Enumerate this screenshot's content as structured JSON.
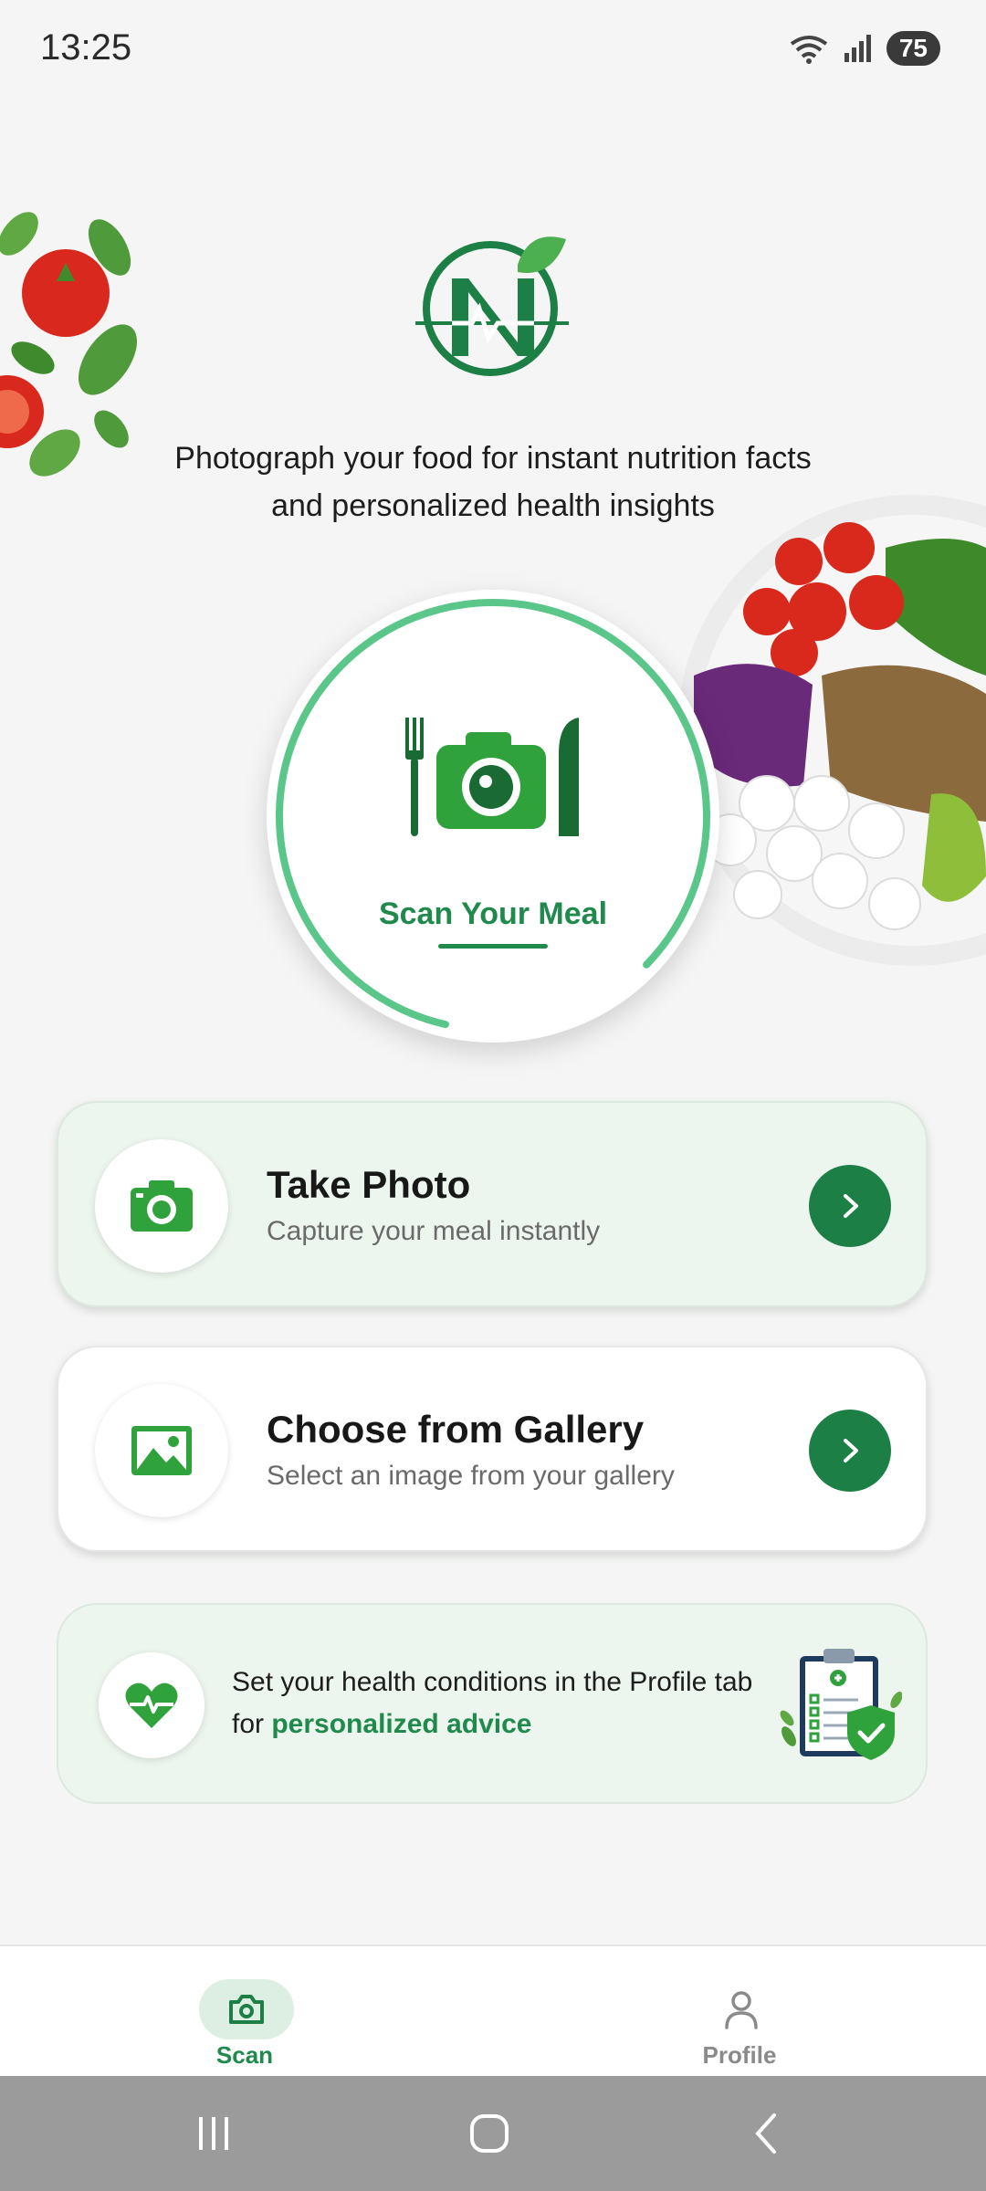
{
  "status": {
    "time": "13:25",
    "battery": "75"
  },
  "tagline": {
    "line1": "Photograph your food for instant nutrition facts",
    "line2": "and personalized health insights"
  },
  "scan": {
    "label": "Scan Your Meal",
    "icon": "camera-with-cutlery-icon"
  },
  "actions": [
    {
      "title": "Take Photo",
      "subtitle": "Capture your meal instantly",
      "icon": "camera-icon"
    },
    {
      "title": "Choose from Gallery",
      "subtitle": "Select an image from your gallery",
      "icon": "image-icon"
    }
  ],
  "info": {
    "text_before": "Set your health conditions in the Profile tab for ",
    "highlight": "personalized advice",
    "icon": "heart-pulse-icon"
  },
  "nav": {
    "scan_label": "Scan",
    "profile_label": "Profile"
  },
  "colors": {
    "accent": "#1f8a4c",
    "accent_dark": "#1c7f45",
    "card_tint": "#ecf5ee",
    "background": "#f4f5f4"
  }
}
